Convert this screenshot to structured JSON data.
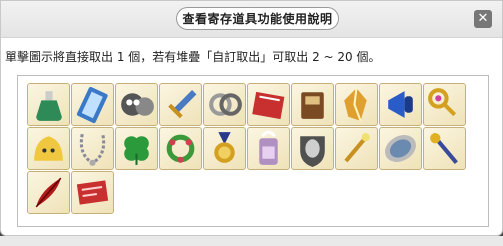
{
  "dialog": {
    "title": "查看寄存道具功能使用說明",
    "close_label": "✕",
    "instruction": "單擊圖示將直接取出 1 個，若有堆疊「自訂取出」可取出 2 ~ 20 個。"
  },
  "items": [
    {
      "icon": "green-potion-icon",
      "color": "#2e8b57"
    },
    {
      "icon": "blue-crystal-card-icon",
      "color": "#3a78c8"
    },
    {
      "icon": "skull-cannon-icon",
      "color": "#555555"
    },
    {
      "icon": "sword-icon",
      "color": "#4a7ac2"
    },
    {
      "icon": "silver-rings-icon",
      "color": "#9a9a9a"
    },
    {
      "icon": "red-scroll-icon",
      "color": "#c83030"
    },
    {
      "icon": "brown-book-icon",
      "color": "#7a4a22"
    },
    {
      "icon": "gold-crystal-icon",
      "color": "#e0a030"
    },
    {
      "icon": "blue-megaphone-icon",
      "color": "#2a5cc8"
    },
    {
      "icon": "golden-key-icon",
      "color": "#d4a020"
    },
    {
      "icon": "yellow-slime-icon",
      "color": "#f0c840"
    },
    {
      "icon": "silver-necklace-icon",
      "color": "#8a8a9a"
    },
    {
      "icon": "four-leaf-clover-icon",
      "color": "#2a9a3a"
    },
    {
      "icon": "flower-wreath-icon",
      "color": "#d04050"
    },
    {
      "icon": "gold-medal-icon",
      "color": "#d4a020"
    },
    {
      "icon": "gift-bottle-icon",
      "color": "#b090c0"
    },
    {
      "icon": "face-shield-icon",
      "color": "#505050"
    },
    {
      "icon": "golden-wand-icon",
      "color": "#c89020"
    },
    {
      "icon": "silver-mirror-icon",
      "color": "#6a8ab0"
    },
    {
      "icon": "gem-staff-icon",
      "color": "#3a4a9a"
    },
    {
      "icon": "red-feather-icon",
      "color": "#b01a1a"
    },
    {
      "icon": "red-ticket-icon",
      "color": "#c83030"
    }
  ]
}
